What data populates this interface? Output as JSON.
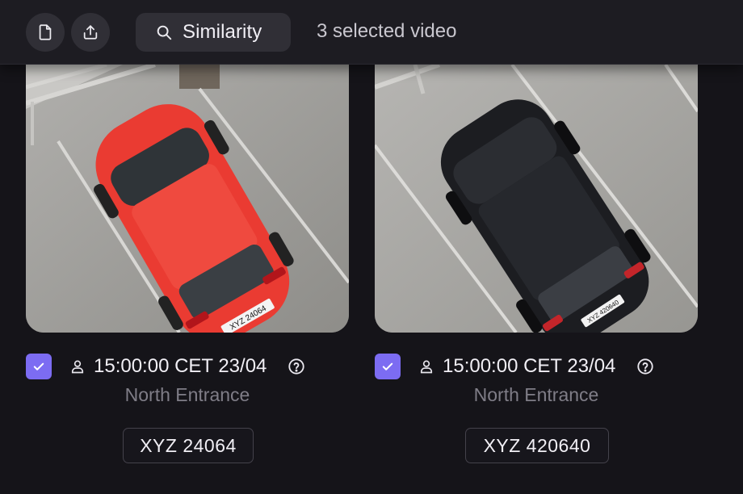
{
  "toolbar": {
    "document_icon": "document-icon",
    "export_icon": "upload-icon",
    "similarity_label": "Similarity",
    "similarity_icon": "search-icon",
    "selected_text": "3 selected video"
  },
  "colors": {
    "background": "#151419",
    "toolbar": "#1d1c22",
    "button": "#302f36",
    "checkbox_accent": "#7c6cf2",
    "muted_text": "#7f7d87"
  },
  "cards": [
    {
      "selected": true,
      "timestamp": "15:00:00 CET 23/04",
      "location": "North Entrance",
      "plate": "XYZ 24064",
      "car_color": "red",
      "thumb_plate_text": "XYZ 24064"
    },
    {
      "selected": true,
      "timestamp": "15:00:00 CET 23/04",
      "location": "North Entrance",
      "plate": "XYZ 420640",
      "car_color": "black",
      "thumb_plate_text": "XYZ 420640"
    }
  ]
}
